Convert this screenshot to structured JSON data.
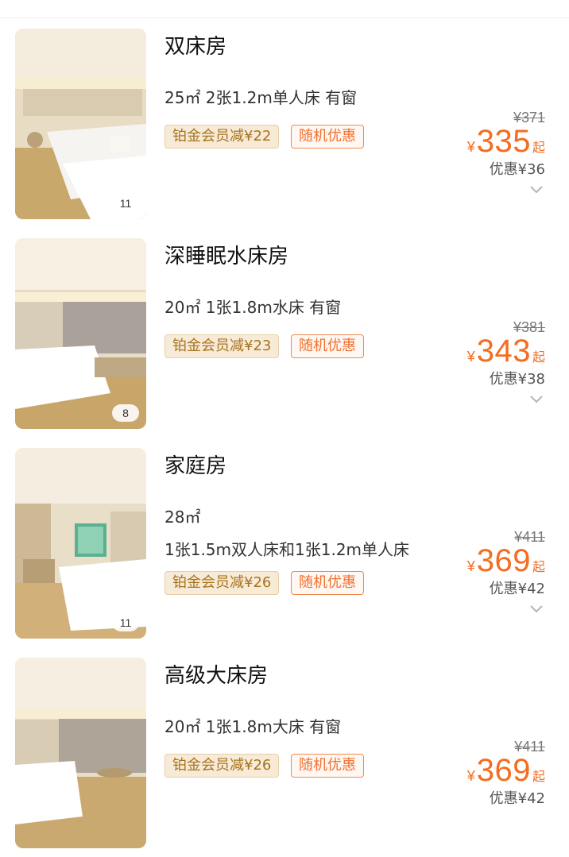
{
  "rooms": [
    {
      "name": "双床房",
      "spec_lines": [
        "25㎡  2张1.2m单人床  有窗"
      ],
      "photo_count": "11",
      "member_tag": "铂金会员减¥22",
      "random_tag": "随机优惠",
      "original_price": "¥371",
      "currency": "¥",
      "price": "335",
      "price_suffix": "起",
      "discount": "优惠¥36",
      "icon": "chevron-down-icon"
    },
    {
      "name": "深睡眠水床房",
      "spec_lines": [
        "20㎡  1张1.8m水床  有窗"
      ],
      "photo_count": "8",
      "member_tag": "铂金会员减¥23",
      "random_tag": "随机优惠",
      "original_price": "¥381",
      "currency": "¥",
      "price": "343",
      "price_suffix": "起",
      "discount": "优惠¥38",
      "icon": "chevron-down-icon"
    },
    {
      "name": "家庭房",
      "spec_lines": [
        "28㎡",
        "1张1.5m双人床和1张1.2m单人床"
      ],
      "photo_count": "11",
      "member_tag": "铂金会员减¥26",
      "random_tag": "随机优惠",
      "original_price": "¥411",
      "currency": "¥",
      "price": "369",
      "price_suffix": "起",
      "discount": "优惠¥42",
      "icon": "chevron-down-icon"
    },
    {
      "name": "高级大床房",
      "spec_lines": [
        "20㎡  1张1.8m大床  有窗"
      ],
      "photo_count": "",
      "member_tag": "铂金会员减¥26",
      "random_tag": "随机优惠",
      "original_price": "¥411",
      "currency": "¥",
      "price": "369",
      "price_suffix": "起",
      "discount": "优惠¥42",
      "icon": "chevron-down-icon"
    }
  ],
  "colors": {
    "price_accent": "#f46d20",
    "member_tag_bg": "#f7ead6",
    "member_tag_text": "#a8741f",
    "random_tag_border": "#f08a4c"
  }
}
